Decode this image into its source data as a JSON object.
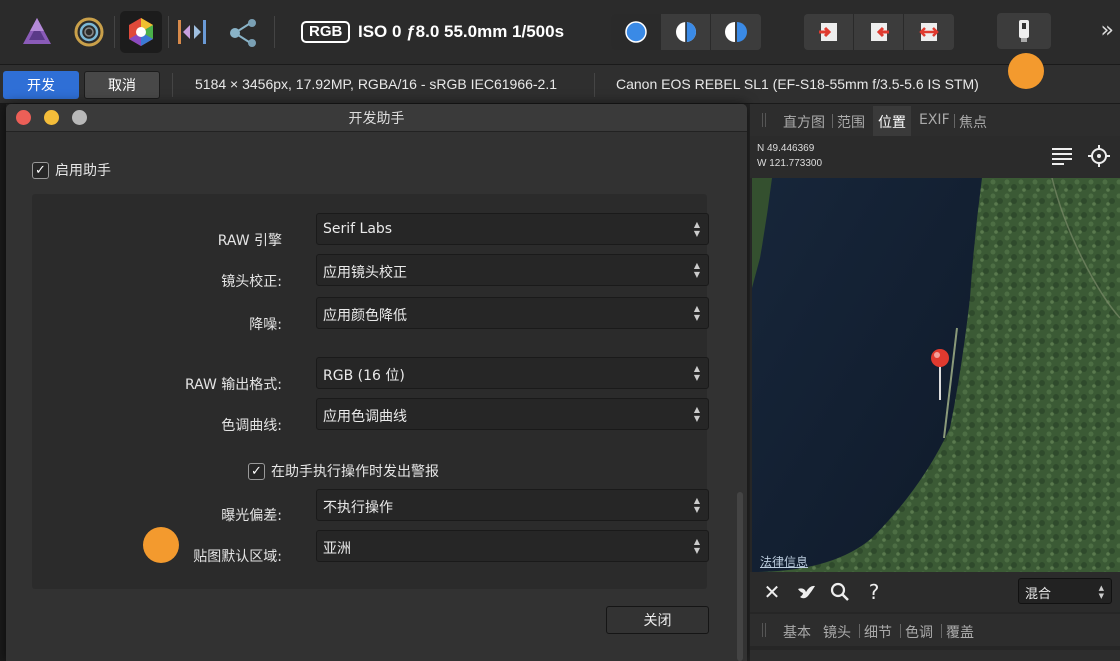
{
  "toolbar": {
    "personas": [
      {
        "name": "photo-persona-icon"
      },
      {
        "name": "liquify-persona-icon"
      },
      {
        "name": "develop-persona-icon"
      },
      {
        "name": "tone-mapping-persona-icon"
      },
      {
        "name": "export-persona-icon"
      }
    ],
    "color_format": "RGB",
    "exif_summary": "ISO 0 ƒ8.0 55.0mm 1/500s",
    "more": "»"
  },
  "contextbar": {
    "develop_label": "开发",
    "cancel_label": "取消",
    "image_info": "5184 × 3456px, 17.92MP, RGBA/16 - sRGB IEC61966-2.1",
    "camera_info": "Canon EOS REBEL SL1 (EF-S18-55mm f/3.5-5.6 IS STM)"
  },
  "dialog": {
    "title": "开发助手",
    "enable_label": "启用助手",
    "raw_engine_label": "RAW 引擎",
    "raw_engine_value": "Serif Labs",
    "lens_label": "镜头校正:",
    "lens_value": "应用镜头校正",
    "noise_label": "降噪:",
    "noise_value": "应用颜色降低",
    "output_label": "RAW 输出格式:",
    "output_value": "RGB (16 位)",
    "tone_label": "色调曲线:",
    "tone_value": "应用色调曲线",
    "warn_label": "在助手执行操作时发出警报",
    "exposure_label": "曝光偏差:",
    "exposure_value": "不执行操作",
    "region_label": "贴图默认区域:",
    "region_value": "亚洲",
    "close_label": "关闭"
  },
  "rightpanel": {
    "tabs": [
      "直方图",
      "范围",
      "位置",
      "EXIF",
      "焦点"
    ],
    "active_tab": "位置",
    "lat": "N 49.446369",
    "lon": "W 121.773300",
    "legal": "法律信息",
    "blend_mode": "混合",
    "tabs2": [
      "基本",
      "镜头",
      "细节",
      "色调",
      "覆盖"
    ]
  },
  "colors": {
    "accent": "#2f6fd6",
    "marker": "#f39a2e",
    "pin": "#e03a2f"
  }
}
